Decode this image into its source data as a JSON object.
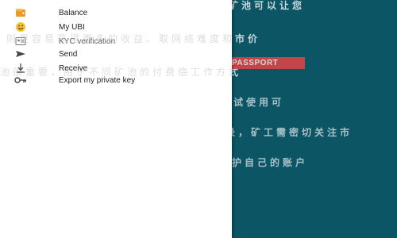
{
  "menu": {
    "items": [
      {
        "label": "Balance",
        "icon": "wallet-icon"
      },
      {
        "label": "My UBI",
        "icon": "smiley-icon"
      },
      {
        "label": "KYC verification",
        "icon": "id-card-icon"
      },
      {
        "label": "Send",
        "icon": "send-icon"
      },
      {
        "label": "Receive",
        "icon": "receive-icon"
      },
      {
        "label": "Export my private key",
        "icon": "key-icon"
      }
    ]
  },
  "background": {
    "lines": [
      "虽然我们有各种各样的选择，找一个好的矿池可以让您",
      "量大，则更容易获得更多的收益。取网络难度和市价",
      "择适合的矿池很重要，由于不同矿池的付费偿工作方式",
      "定期检查矿池的表现以及与其他矿工开始尝试使用可",
      "选择矿池时注意矿池的收费、规则和历史记录，矿工需密切关注市",
      "络的波动，并由合适的选择以及采用安全措施来保护自己的账户"
    ],
    "stamp_text": "PASSPORT"
  },
  "colors": {
    "background": "#0b5565",
    "menu_background": "#ffffff",
    "stamp": "#d94444"
  }
}
